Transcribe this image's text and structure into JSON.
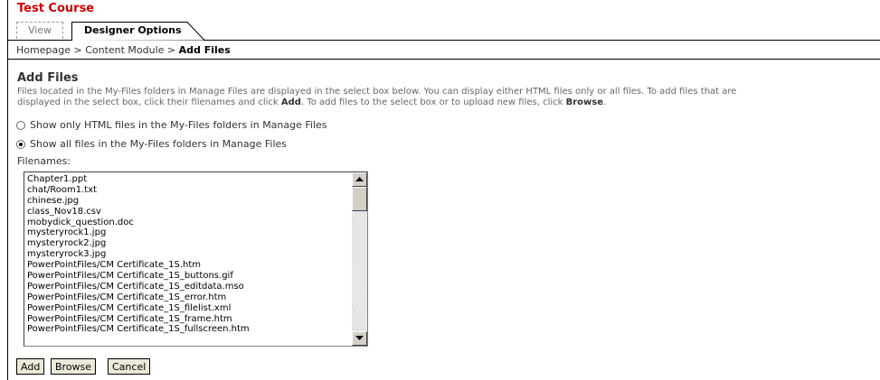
{
  "course": {
    "title": "Test Course"
  },
  "tabs": [
    {
      "label": "View"
    },
    {
      "label": "Designer Options"
    }
  ],
  "breadcrumb": {
    "home": "Homepage",
    "sep1": " > ",
    "module": "Content Module",
    "sep2": " > ",
    "current": "Add Files"
  },
  "section": {
    "title": "Add Files",
    "desc_line1": "Files located in the My-Files folders in Manage Files are displayed in the select box below. You can display either HTML files only or all files. To add files that are",
    "desc_line2_a": "displayed in the select box, click their filenames and click ",
    "desc_line2_add": "Add",
    "desc_line2_b": ". To add files to the select box or to upload new files, click ",
    "desc_line2_browse": "Browse",
    "desc_line2_c": "."
  },
  "filter": {
    "options": [
      {
        "label": "Show only HTML files in the My-Files folders in Manage Files",
        "checked": false
      },
      {
        "label": "Show all files in the My-Files folders in Manage Files",
        "checked": true
      }
    ]
  },
  "files": {
    "label": "Filenames:",
    "items": [
      "Chapter1.ppt",
      "chat/Room1.txt",
      "chinese.jpg",
      "class_Nov18.csv",
      "mobydick_question.doc",
      "mysteryrock1.jpg",
      "mysteryrock2.jpg",
      "mysteryrock3.jpg",
      "PowerPointFiles/CM Certificate_1S.htm",
      "PowerPointFiles/CM Certificate_1S_buttons.gif",
      "PowerPointFiles/CM Certificate_1S_editdata.mso",
      "PowerPointFiles/CM Certificate_1S_error.htm",
      "PowerPointFiles/CM Certificate_1S_filelist.xml",
      "PowerPointFiles/CM Certificate_1S_frame.htm",
      "PowerPointFiles/CM Certificate_1S_fullscreen.htm"
    ]
  },
  "buttons": {
    "add": "Add",
    "browse": "Browse",
    "cancel": "Cancel"
  },
  "colors": {
    "course_title": "#cc0000"
  }
}
